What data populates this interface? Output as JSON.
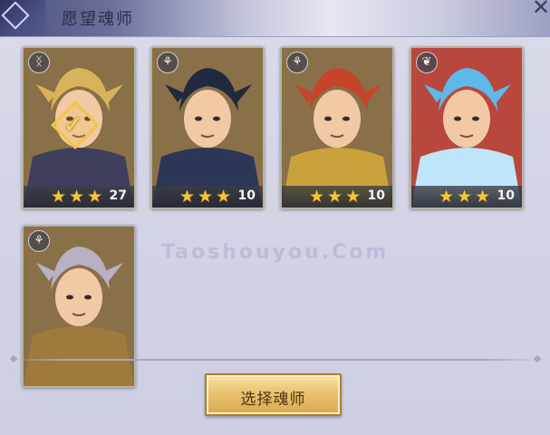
{
  "header": {
    "title": "愿望魂师",
    "close_icon": "close-x-icon"
  },
  "cards": [
    {
      "name": "card-1",
      "stars": "★★★",
      "level": "27",
      "badge_icon": "control-type-icon",
      "badge": "ᛝ",
      "selected": true,
      "colors": {
        "bg": "#8a7048",
        "hair": "#d7b35a",
        "cloth": "#3d3f5c"
      }
    },
    {
      "name": "card-2",
      "stars": "★★★",
      "level": "10",
      "badge_icon": "tree-type-icon",
      "badge": "⚘",
      "selected": false,
      "colors": {
        "bg": "#8a7048",
        "hair": "#1f2a3f",
        "cloth": "#2c3657"
      }
    },
    {
      "name": "card-3",
      "stars": "★★★",
      "level": "10",
      "badge_icon": "tree-type-icon",
      "badge": "⚘",
      "selected": false,
      "colors": {
        "bg": "#8a7048",
        "hair": "#c6442a",
        "cloth": "#c9a23c"
      }
    },
    {
      "name": "card-4",
      "stars": "★★★",
      "level": "10",
      "badge_icon": "wing-type-icon",
      "badge": "❦",
      "selected": false,
      "colors": {
        "bg": "#b8473e",
        "hair": "#5fb9e8",
        "cloth": "#bfe6f8"
      }
    },
    {
      "name": "card-5",
      "stars": "",
      "level": "",
      "badge_icon": "tree-type-icon",
      "badge": "⚘",
      "selected": false,
      "colors": {
        "bg": "#8a7048",
        "hair": "#b7b1c3",
        "cloth": "#a07a3c"
      }
    }
  ],
  "watermark": {
    "text": "Taoshouyou.Com"
  },
  "footer": {
    "select_button": "选择魂师"
  }
}
